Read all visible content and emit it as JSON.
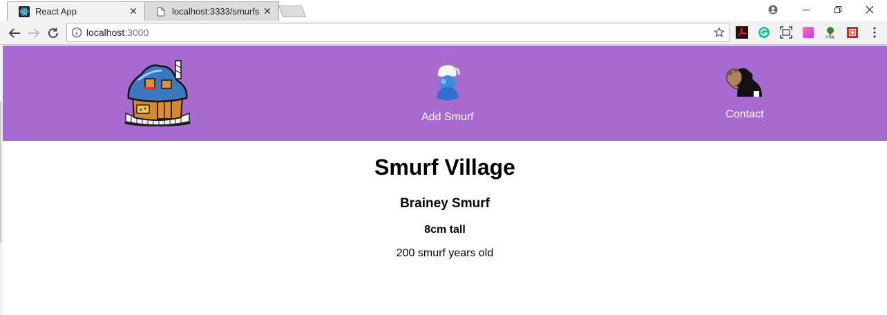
{
  "browser": {
    "tabs": [
      {
        "title": "React App",
        "active": true
      },
      {
        "title": "localhost:3333/smurfs",
        "active": false
      }
    ],
    "address": {
      "host": "localhost",
      "port": ":3000"
    }
  },
  "navbar": {
    "background": "#a76ad1",
    "items": [
      {
        "label": "",
        "icon": "smurf-house-icon"
      },
      {
        "label": "Add Smurf",
        "icon": "smurf-icon"
      },
      {
        "label": "Contact",
        "icon": "contact-smurf-icon"
      }
    ]
  },
  "main": {
    "title": "Smurf Village",
    "smurf": {
      "name": "Brainey Smurf",
      "height": "8cm tall",
      "age": "200 smurf years old"
    }
  }
}
